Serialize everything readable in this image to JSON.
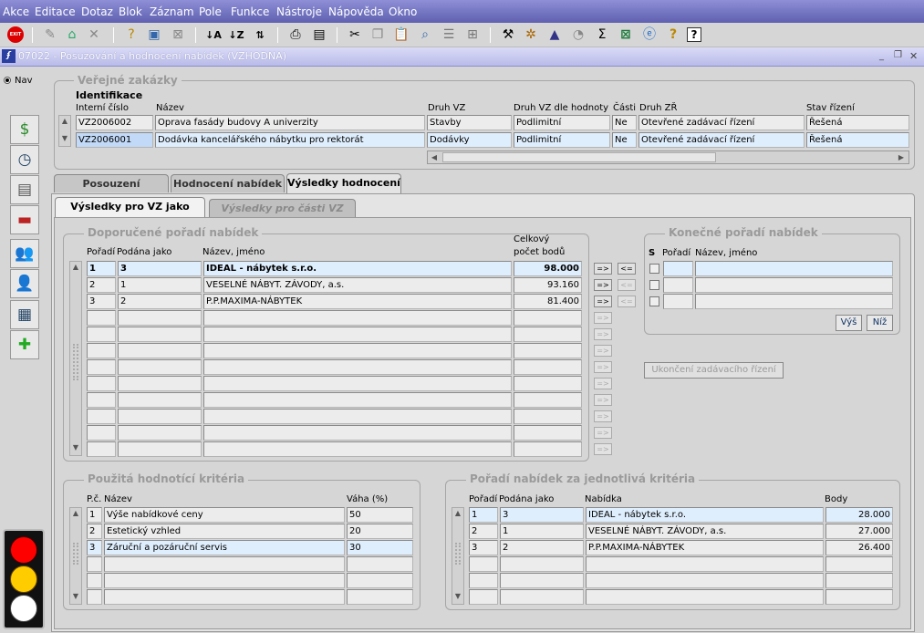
{
  "menu": [
    "Akce",
    "Editace",
    "Dotaz",
    "Blok",
    "Záznam",
    "Pole",
    "Funkce",
    "Nástroje",
    "Nápověda",
    "Okno"
  ],
  "toolbar_icons": [
    "exit-icon",
    "insert-record-icon",
    "save-icon",
    "delete-icon",
    "query-icon",
    "execute-query-icon",
    "cancel-query-icon",
    "sort-asc-icon",
    "sort-desc-icon",
    "sort-icon",
    "print-icon",
    "print-preview-icon",
    "cut-icon",
    "copy-icon",
    "paste-icon",
    "find-icon",
    "list-icon",
    "tree-icon",
    "tools-icon",
    "settings-icon",
    "chart-icon",
    "calc-icon",
    "sum-icon",
    "excel-icon",
    "ie-icon",
    "key-help-icon",
    "help-icon"
  ],
  "toolbar_exit_label": "EXIT",
  "window": {
    "title": "07022 - Posuzování a hodnocení nabídek (VZHODNA)",
    "nav_label": "Nav"
  },
  "verejne_zakazky": {
    "title": "Veřejné zakázky",
    "subtitle": "Identifikace",
    "headers": {
      "interni_cislo": "Interní číslo",
      "nazev": "Název",
      "druh_vz": "Druh VZ",
      "druh_vz_hodnoty": "Druh VZ dle hodnoty",
      "casti": "Části",
      "druh_zr": "Druh ZŘ",
      "stav": "Stav řízení"
    },
    "rows": [
      {
        "cislo": "VZ2006002",
        "nazev": "Oprava fasády budovy A univerzity",
        "druh": "Stavby",
        "hodnota": "Podlimitní",
        "casti": "Ne",
        "zr": "Otevřené zadávací řízení",
        "stav": "Řešená"
      },
      {
        "cislo": "VZ2006001",
        "nazev": "Dodávka kancelářského nábytku pro rektorát",
        "druh": "Dodávky",
        "hodnota": "Podlimitní",
        "casti": "Ne",
        "zr": "Otevřené zadávací řízení",
        "stav": "Řešená"
      }
    ]
  },
  "tabs": [
    "Posouzení",
    "Hodnocení nabídek",
    "Výsledky hodnocení"
  ],
  "subtabs": [
    "Výsledky pro VZ jako celek",
    "Výsledky pro části VZ"
  ],
  "doporucene": {
    "title": "Doporučené pořadí nabídek",
    "headers": {
      "poradi": "Pořadí",
      "podana": "Podána jako",
      "nazev": "Název, jméno",
      "celkovy1": "Celkový",
      "celkovy2": "počet bodů"
    },
    "rows": [
      {
        "poradi": "1",
        "podana": "3",
        "nazev": "IDEAL - nábytek s.r.o.",
        "body": "98.000"
      },
      {
        "poradi": "2",
        "podana": "1",
        "nazev": "VESELNÉ NÁBYT. ZÁVODY, a.s.",
        "body": "93.160"
      },
      {
        "poradi": "3",
        "podana": "2",
        "nazev": "P.P.MAXIMA-NÁBYTEK",
        "body": "81.400"
      }
    ],
    "move_right": "=>",
    "move_left": "<="
  },
  "konecne": {
    "title": "Konečné pořadí nabídek",
    "headers": {
      "s": "S",
      "poradi": "Pořadí",
      "nazev": "Název, jméno"
    },
    "up_button": "Výš",
    "down_button": "Níž",
    "end_button": "Ukončení zadávacího řízení"
  },
  "kriteria": {
    "title": "Použitá hodnotící kritéria",
    "headers": {
      "pc": "P.č.",
      "nazev": "Název",
      "vaha": "Váha (%)"
    },
    "rows": [
      {
        "pc": "1",
        "nazev": "Výše nabídkové ceny",
        "vaha": "50"
      },
      {
        "pc": "2",
        "nazev": "Estetický vzhled",
        "vaha": "20"
      },
      {
        "pc": "3",
        "nazev": "Záruční a pozáruční servis",
        "vaha": "30"
      }
    ]
  },
  "poradi_kriteria": {
    "title": "Pořadí nabídek za jednotlivá kritéria",
    "headers": {
      "poradi": "Pořadí",
      "podana": "Podána jako",
      "nabidka": "Nabídka",
      "body": "Body"
    },
    "rows": [
      {
        "poradi": "1",
        "podana": "3",
        "nabidka": "IDEAL - nábytek s.r.o.",
        "body": "28.000"
      },
      {
        "poradi": "2",
        "podana": "1",
        "nabidka": "VESELNÉ NÁBYT. ZÁVODY, a.s.",
        "body": "27.000"
      },
      {
        "poradi": "3",
        "podana": "2",
        "nabidka": "P.P.MAXIMA-NÁBYTEK",
        "body": "26.400"
      }
    ]
  },
  "side_icons": [
    "money-icon",
    "clock-icon",
    "notebook-icon",
    "toolbox-icon",
    "users-icon",
    "person-icon",
    "document-icon",
    "add-document-icon"
  ],
  "colors": {
    "menubar": "#6f70c4",
    "selected_row": "#dfeefd",
    "traffic_red": "#ff0000",
    "traffic_yellow": "#ffcc00",
    "traffic_white": "#ffffff"
  }
}
